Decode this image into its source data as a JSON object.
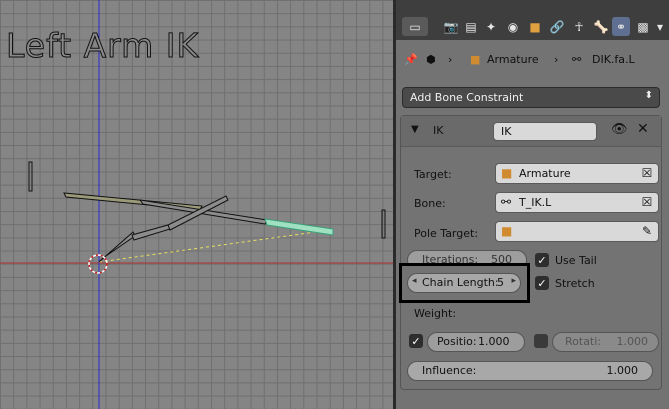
{
  "viewport": {
    "title": "Left Arm IK"
  },
  "tabbar": {
    "tabs": [
      {
        "icon": "editor-type-icon"
      },
      {
        "icon": "render-icon"
      },
      {
        "icon": "render-layers-icon"
      },
      {
        "icon": "scene-icon"
      },
      {
        "icon": "world-icon"
      },
      {
        "icon": "object-icon"
      },
      {
        "icon": "constraints-icon"
      },
      {
        "icon": "armature-data-icon"
      },
      {
        "icon": "bone-icon"
      },
      {
        "icon": "bone-constraints-icon"
      },
      {
        "icon": "material-icon"
      }
    ],
    "selected_index": 9
  },
  "path": {
    "pin_icon": "pin-icon",
    "object": "Armature",
    "bone": "DIK.fa.L"
  },
  "add_constraint": {
    "label": "Add Bone Constraint"
  },
  "constraint": {
    "type_label": "IK",
    "name_value": "IK",
    "target_label": "Target:",
    "target_value": "Armature",
    "bone_label": "Bone:",
    "bone_value": "T_IK.L",
    "pole_label": "Pole Target:",
    "iterations_label": "Iterations:",
    "iterations_value": "500",
    "chain_label": "Chain Length:",
    "chain_value": "5",
    "use_tail_label": "Use Tail",
    "stretch_label": "Stretch",
    "weight_label": "Weight:",
    "position_label": "Positio:",
    "position_value": "1.000",
    "rotation_label": "Rotati:",
    "rotation_value": "1.000",
    "influence_label": "Influence:",
    "influence_value": "1.000"
  },
  "colors": {
    "header_bg": "#3e3e3e",
    "panel_bg": "#737373",
    "selected_tab": "#5f6f91",
    "highlight_box": "#000000",
    "selected_bone": "#9fe0c0",
    "x_axis": "#b03030",
    "y_axis": "#2a2ad0"
  }
}
